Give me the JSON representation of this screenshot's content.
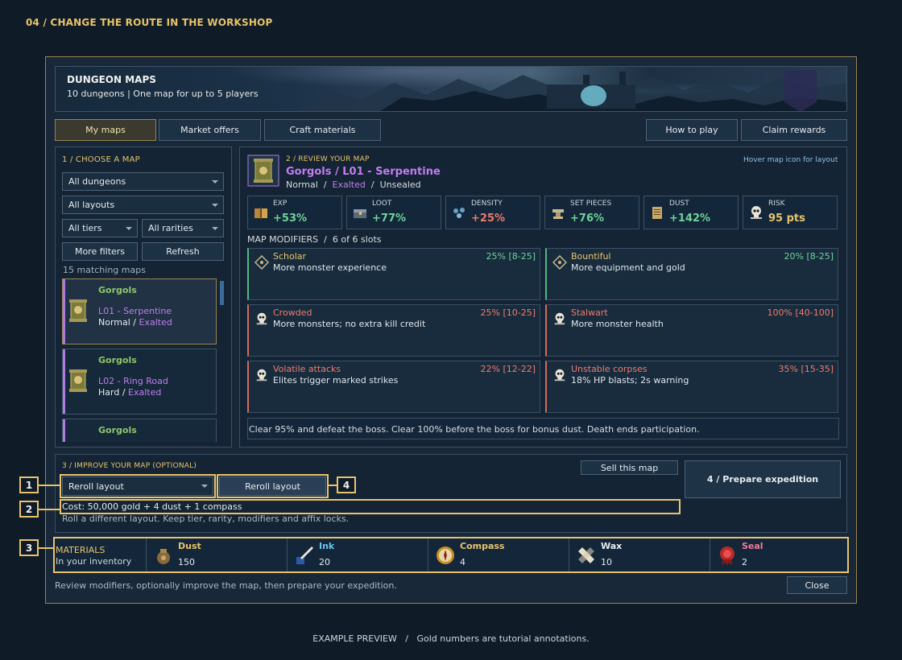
{
  "page_title": "04 / CHANGE THE ROUTE IN THE WORKSHOP",
  "banner": {
    "title": "DUNGEON MAPS",
    "subtitle": "10 dungeons | One map for up to 5 players"
  },
  "tabs": {
    "my_maps": "My maps",
    "market_offers": "Market offers",
    "craft_materials": "Craft materials",
    "how_to_play": "How to play",
    "claim_rewards": "Claim rewards"
  },
  "choose": {
    "label": "1 / CHOOSE A MAP",
    "dungeon_filter": "All dungeons",
    "layout_filter": "All layouts",
    "tier_filter": "All tiers",
    "rarity_filter": "All rarities",
    "more_filters": "More filters",
    "refresh": "Refresh",
    "matching": "15 matching maps",
    "maps": [
      {
        "zone": "Gorgols",
        "name": "L01 - Serpentine",
        "difficulty": "Normal",
        "rarity": "Exalted"
      },
      {
        "zone": "Gorgols",
        "name": "L02 - Ring Road",
        "difficulty": "Hard",
        "rarity": "Exalted"
      },
      {
        "zone": "Gorgols"
      }
    ]
  },
  "review": {
    "label": "2 / REVIEW YOUR MAP",
    "hint": "Hover map icon for layout",
    "map_title": "Gorgols / L01 - Serpentine",
    "difficulty": "Normal",
    "rarity": "Exalted",
    "seal_state": "Unsealed",
    "sep": "/",
    "stats": [
      {
        "label": "EXP",
        "value": "+53%",
        "icon": "book-icon"
      },
      {
        "label": "LOOT",
        "value": "+77%",
        "icon": "chest-icon"
      },
      {
        "label": "DENSITY",
        "value": "+25%",
        "icon": "swarm-icon"
      },
      {
        "label": "SET PIECES",
        "value": "+76%",
        "icon": "anvil-icon"
      },
      {
        "label": "DUST",
        "value": "+142%",
        "icon": "scroll-icon"
      },
      {
        "label": "RISK",
        "value": "95 pts",
        "icon": "skull-icon"
      }
    ],
    "modifiers_label": "MAP MODIFIERS",
    "modifiers_slots": "6 of 6 slots",
    "modifiers": [
      {
        "name": "Scholar",
        "desc": "More monster experience",
        "range": "25% [8-25]",
        "kind": "good"
      },
      {
        "name": "Bountiful",
        "desc": "More equipment and gold",
        "range": "20% [8-25]",
        "kind": "good"
      },
      {
        "name": "Crowded",
        "desc": "More monsters; no extra kill credit",
        "range": "25% [10-25]",
        "kind": "bad"
      },
      {
        "name": "Stalwart",
        "desc": "More monster health",
        "range": "100% [40-100]",
        "kind": "bad"
      },
      {
        "name": "Volatile attacks",
        "desc": "Elites trigger marked strikes",
        "range": "22% [12-22]",
        "kind": "bad"
      },
      {
        "name": "Unstable corpses",
        "desc": "18% HP blasts; 2s warning",
        "range": "35% [15-35]",
        "kind": "bad"
      }
    ],
    "objective": "Clear 95% and defeat the boss. Clear 100% before the boss for bonus dust. Death ends participation."
  },
  "improve": {
    "label": "3 / IMPROVE YOUR MAP (OPTIONAL)",
    "sell": "Sell this map",
    "prepare": "4 / Prepare expedition",
    "craft_select": "Reroll layout",
    "craft_button": "Reroll layout",
    "cost": "Cost: 50,000 gold + 4 dust + 1 compass",
    "description": "Roll a different layout. Keep tier, rarity, modifiers and affix locks."
  },
  "materials": {
    "label": "MATERIALS",
    "sublabel": "In your inventory",
    "items": [
      {
        "name": "Dust",
        "count": "150",
        "color": "#e8c36b",
        "icon": "dust-pouch-icon"
      },
      {
        "name": "Ink",
        "count": "20",
        "color": "#6cc3f0",
        "icon": "ink-quill-icon"
      },
      {
        "name": "Compass",
        "count": "4",
        "color": "#e8c36b",
        "icon": "compass-icon"
      },
      {
        "name": "Wax",
        "count": "10",
        "color": "#e6ebef",
        "icon": "wax-icon"
      },
      {
        "name": "Seal",
        "count": "2",
        "color": "#f07a9a",
        "icon": "seal-icon"
      }
    ]
  },
  "footer": {
    "hint": "Review modifiers, optionally improve the map, then prepare your expedition.",
    "close": "Close"
  },
  "annotations": [
    "1",
    "2",
    "3",
    "4"
  ],
  "caption": "EXAMPLE PREVIEW   /   Gold numbers are tutorial annotations."
}
